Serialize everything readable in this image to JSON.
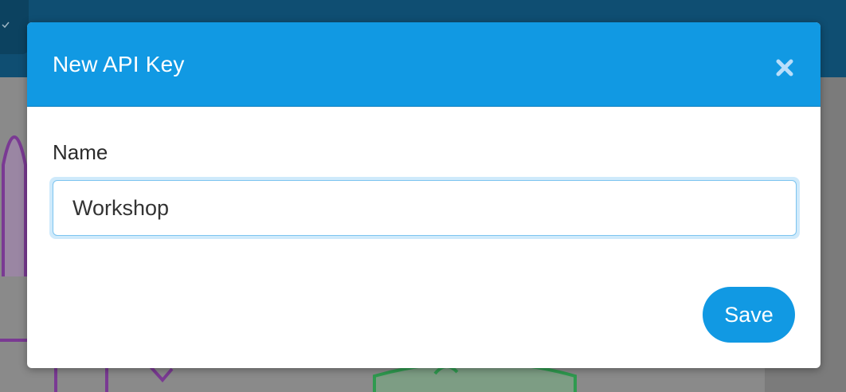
{
  "modal": {
    "title": "New API Key",
    "close_icon": "close-icon",
    "field": {
      "label": "Name",
      "value": "Workshop",
      "placeholder": ""
    },
    "save_label": "Save"
  },
  "colors": {
    "header_bg": "#1199e3",
    "button_bg": "#1199e3",
    "topbar_bg": "#0f4e72",
    "backdrop": "#7f7f7f"
  }
}
